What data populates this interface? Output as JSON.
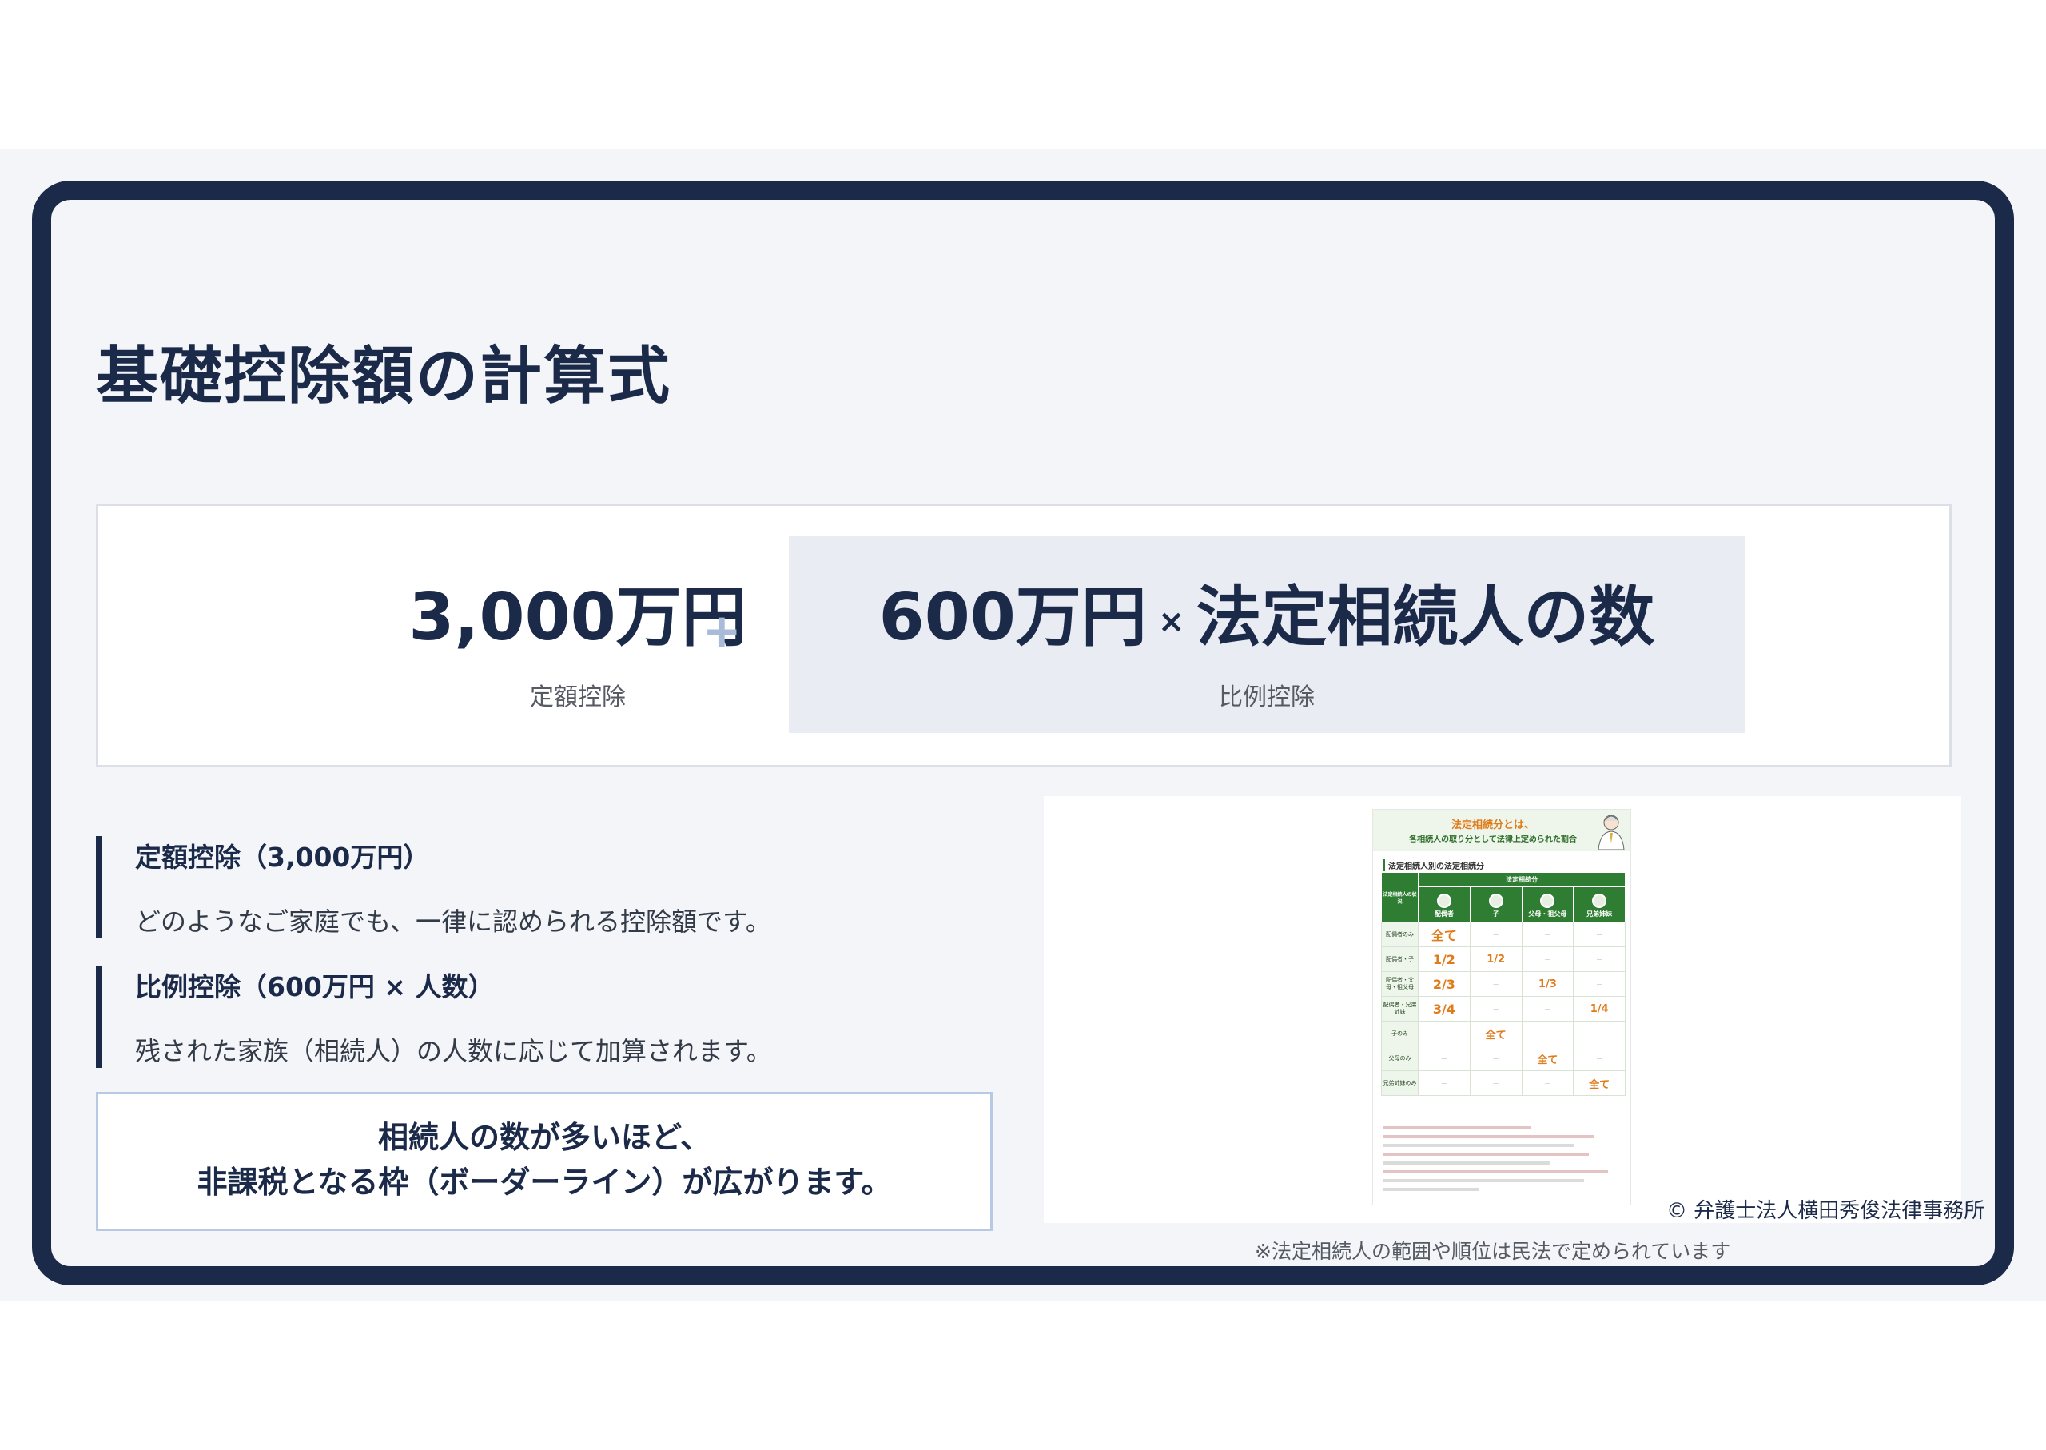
{
  "slide": {
    "title": "基礎控除額の計算式"
  },
  "formula": {
    "fixed_amount": "3,000万円",
    "fixed_label": "定額控除",
    "plus": "+",
    "proportional_amount": "600万円",
    "times": "×",
    "proportional_factor": "法定相続人の数",
    "proportional_label": "比例控除"
  },
  "items": [
    {
      "heading": "定額控除（3,000万円）",
      "description": "どのようなご家庭でも、一律に認められる控除額です。"
    },
    {
      "heading": "比例控除（600万円 × 人数）",
      "description": "残された家族（相続人）の人数に応じて加算されます。"
    }
  ],
  "callout": {
    "line1": "相続人の数が多いほど、",
    "line2": "非課税となる枠（ボーダーライン）が広がります。"
  },
  "embedded_image": {
    "heading_accent": "法定相続分とは、",
    "heading_sub": "各相続人の取り分として法律上定められた割合",
    "section_title": "法定相続人別の法定相続分",
    "table_group_header": "法定相続分",
    "corner_header": "法定相続人の状況",
    "column_headers": [
      "配偶者",
      "子",
      "父母・祖父母",
      "兄弟姉妹"
    ],
    "rows": [
      {
        "label": "配偶者のみ",
        "cells": [
          "全て",
          "—",
          "—",
          "—"
        ]
      },
      {
        "label": "配偶者・子",
        "cells": [
          "1/2",
          "1/2",
          "—",
          "—"
        ]
      },
      {
        "label": "配偶者・父母・祖父母",
        "cells": [
          "2/3",
          "—",
          "1/3",
          "—"
        ]
      },
      {
        "label": "配偶者・兄弟姉妹",
        "cells": [
          "3/4",
          "—",
          "—",
          "1/4"
        ]
      },
      {
        "label": "子のみ",
        "cells": [
          "—",
          "全て",
          "—",
          "—"
        ]
      },
      {
        "label": "父母のみ",
        "cells": [
          "—",
          "—",
          "全て",
          "—"
        ]
      },
      {
        "label": "兄弟姉妹のみ",
        "cells": [
          "—",
          "—",
          "—",
          "全て"
        ]
      }
    ],
    "highlight_color": "#e07b19",
    "header_color": "#2e7d32"
  },
  "copyright": "© 弁護士法人横田秀俊法律事務所",
  "footnote": "※法定相続人の範囲や順位は民法で定められています",
  "colors": {
    "navy": "#1c2a4a",
    "panel": "#e9edf3",
    "background": "#f3f5f9",
    "callout_border": "#b8c9e3"
  }
}
